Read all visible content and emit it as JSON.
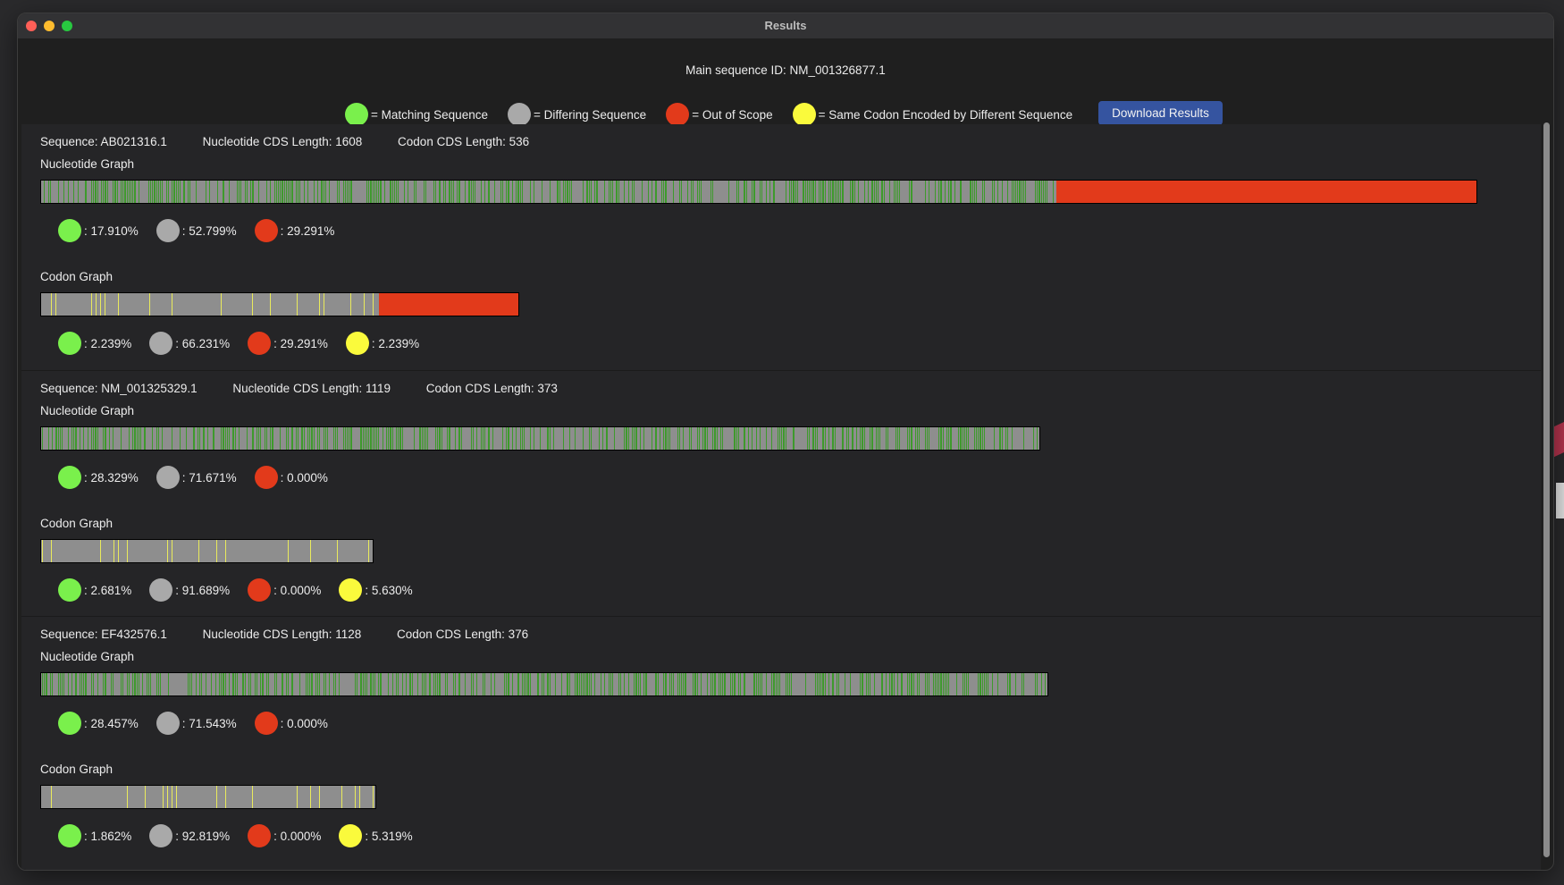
{
  "window": {
    "title": "Results"
  },
  "header": {
    "main_id": "Main sequence ID: NM_001326877.1",
    "legend": [
      {
        "color": "green",
        "label": "= Matching Sequence"
      },
      {
        "color": "gray",
        "label": "= Differing Sequence"
      },
      {
        "color": "red",
        "label": "= Out of Scope"
      },
      {
        "color": "yellow",
        "label": "= Same Codon Encoded by Different Sequence"
      }
    ],
    "download_label": "Download Results"
  },
  "colors": {
    "green": "#7af04c",
    "gray": "#a9a9a9",
    "red": "#e23a1b",
    "yellow": "#fafa3c",
    "bar_gray": "#8e8e8e",
    "bar_green_stripe": "#3e9a2c",
    "bar_yellow_stripe": "#e9ea5c",
    "button": "#3554a0"
  },
  "sequences": [
    {
      "id_label": "Sequence: AB021316.1",
      "nuc_len_label": "Nucleotide CDS Length: 1608",
      "codon_len_label": "Codon CDS Length: 536",
      "nucleotide": {
        "title": "Nucleotide Graph",
        "stats": [
          {
            "color": "green",
            "text": ": 17.910%"
          },
          {
            "color": "gray",
            "text": ": 52.799%"
          },
          {
            "color": "red",
            "text": ": 29.291%"
          }
        ],
        "out_of_scope_fraction": 0.29291
      },
      "codon": {
        "title": "Codon Graph",
        "stats": [
          {
            "color": "green",
            "text": ": 2.239%"
          },
          {
            "color": "gray",
            "text": ": 66.231%"
          },
          {
            "color": "red",
            "text": ": 29.291%"
          },
          {
            "color": "yellow",
            "text": ": 2.239%"
          }
        ],
        "out_of_scope_fraction": 0.29291
      }
    },
    {
      "id_label": "Sequence: NM_001325329.1",
      "nuc_len_label": "Nucleotide CDS Length: 1119",
      "codon_len_label": "Codon CDS Length: 373",
      "nucleotide": {
        "title": "Nucleotide Graph",
        "stats": [
          {
            "color": "green",
            "text": ": 28.329%"
          },
          {
            "color": "gray",
            "text": ": 71.671%"
          },
          {
            "color": "red",
            "text": ": 0.000%"
          }
        ],
        "out_of_scope_fraction": 0
      },
      "codon": {
        "title": "Codon Graph",
        "stats": [
          {
            "color": "green",
            "text": ": 2.681%"
          },
          {
            "color": "gray",
            "text": ": 91.689%"
          },
          {
            "color": "red",
            "text": ": 0.000%"
          },
          {
            "color": "yellow",
            "text": ": 5.630%"
          }
        ],
        "out_of_scope_fraction": 0
      }
    },
    {
      "id_label": "Sequence: EF432576.1",
      "nuc_len_label": "Nucleotide CDS Length: 1128",
      "codon_len_label": "Codon CDS Length: 376",
      "nucleotide": {
        "title": "Nucleotide Graph",
        "stats": [
          {
            "color": "green",
            "text": ": 28.457%"
          },
          {
            "color": "gray",
            "text": ": 71.543%"
          },
          {
            "color": "red",
            "text": ": 0.000%"
          }
        ],
        "out_of_scope_fraction": 0
      },
      "codon": {
        "title": "Codon Graph",
        "stats": [
          {
            "color": "green",
            "text": ": 1.862%"
          },
          {
            "color": "gray",
            "text": ": 92.819%"
          },
          {
            "color": "red",
            "text": ": 0.000%"
          },
          {
            "color": "yellow",
            "text": ": 5.319%"
          }
        ],
        "out_of_scope_fraction": 0
      }
    }
  ]
}
